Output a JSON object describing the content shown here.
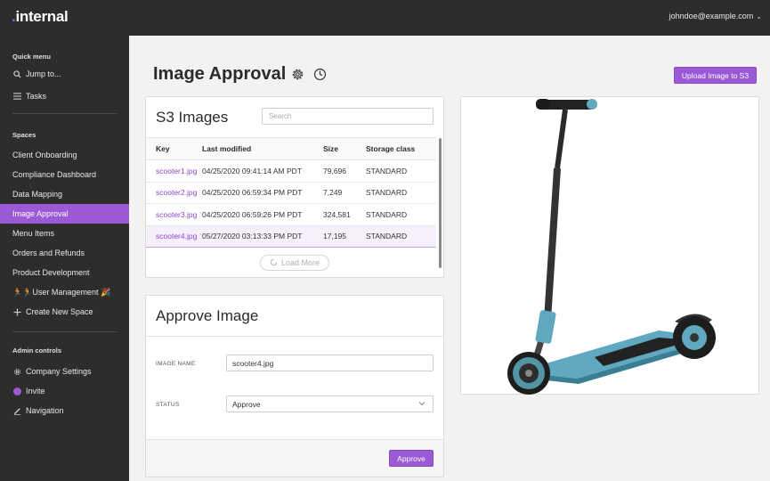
{
  "app": {
    "logo_dot": ".",
    "logo_text": "internal",
    "user_email": "johndoe@example.com",
    "user_chevron": "⌄"
  },
  "sidebar": {
    "quick_menu_label": "Quick menu",
    "quick_items": [
      {
        "label": "Jump to...",
        "icon": "search-icon"
      },
      {
        "label": "Tasks",
        "icon": "list-icon"
      }
    ],
    "spaces_label": "Spaces",
    "spaces": [
      {
        "label": "Client Onboarding"
      },
      {
        "label": "Compliance Dashboard"
      },
      {
        "label": "Data Mapping"
      },
      {
        "label": "Image Approval",
        "active": true
      },
      {
        "label": "Menu Items"
      },
      {
        "label": "Orders and Refunds"
      },
      {
        "label": "Product Development"
      },
      {
        "label": "🏃🏃User Management 🎉"
      },
      {
        "label": "Create New Space",
        "icon": "plus-icon"
      }
    ],
    "admin_label": "Admin controls",
    "admin_items": [
      {
        "label": "Company Settings",
        "icon": "gear-icon"
      },
      {
        "label": "Invite",
        "icon": "invite-icon"
      },
      {
        "label": "Navigation",
        "icon": "pencil-icon"
      }
    ]
  },
  "header": {
    "title": "Image Approval",
    "upload_label": "Upload Image to S3"
  },
  "s3_panel": {
    "title": "S3 Images",
    "search_placeholder": "Search",
    "columns": [
      "Key",
      "Last modified",
      "Size",
      "Storage class"
    ],
    "rows": [
      {
        "key": "scooter1.jpg",
        "modified": "04/25/2020 09:41:14 AM PDT",
        "size": "79,696",
        "storage": "STANDARD"
      },
      {
        "key": "scooter2.jpg",
        "modified": "04/25/2020 06:59:34 PM PDT",
        "size": "7,249",
        "storage": "STANDARD"
      },
      {
        "key": "scooter3.jpg",
        "modified": "04/25/2020 06:59:26 PM PDT",
        "size": "324,581",
        "storage": "STANDARD"
      },
      {
        "key": "scooter4.jpg",
        "modified": "05/27/2020 03:13:33 PM PDT",
        "size": "17,195",
        "storage": "STANDARD",
        "selected": true
      }
    ],
    "load_more": "Load More"
  },
  "approve_panel": {
    "title": "Approve Image",
    "image_name_label": "IMAGE NAME",
    "image_name_value": "scooter4.jpg",
    "status_label": "STATUS",
    "status_value": "Approve",
    "approve_button": "Approve"
  },
  "colors": {
    "accent": "#9b59d6",
    "sidebar_bg": "#2d2d2d",
    "scooter_deck": "#5fa8c0"
  }
}
